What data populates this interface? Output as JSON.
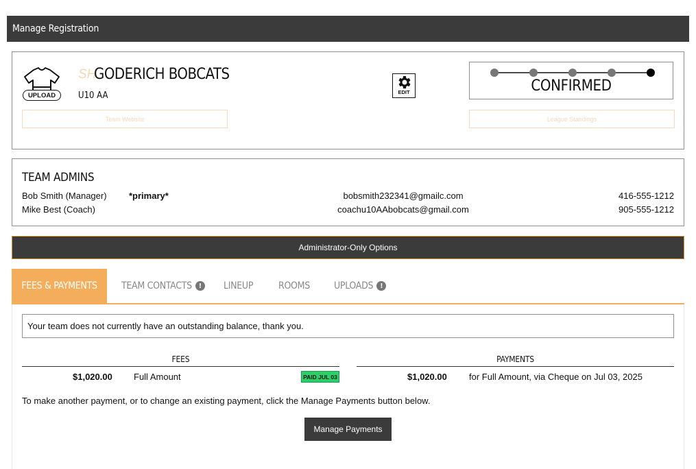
{
  "header": {
    "title": "Manage Registration"
  },
  "team": {
    "upload_label": "UPLOAD",
    "logo_text": "SH",
    "name": "GODERICH BOBCATS",
    "division": "U10 AA",
    "edit_label": "EDIT",
    "status": "CONFIRMED",
    "status_steps": 5,
    "status_current_step": 5,
    "website_label": "Team Website",
    "standings_label": "League Standings"
  },
  "admins": {
    "title": "TEAM ADMINS",
    "rows": [
      {
        "name": "Bob Smith (Manager)",
        "tag": "*primary*",
        "email": "bobsmith232341@gmailc.com",
        "phone": "416-555-1212"
      },
      {
        "name": "Mike Best (Coach)",
        "tag": "",
        "email": "coachu10AAbobcats@gmail.com",
        "phone": "905-555-1212"
      }
    ]
  },
  "admin_options_label": "Administrator-Only Options",
  "tabs": [
    {
      "label": "FEES & PAYMENTS",
      "active": true,
      "alert": false
    },
    {
      "label": "TEAM CONTACTS",
      "active": false,
      "alert": true
    },
    {
      "label": "LINEUP",
      "active": false,
      "alert": false
    },
    {
      "label": "ROOMS",
      "active": false,
      "alert": false
    },
    {
      "label": "UPLOADS",
      "active": false,
      "alert": true
    }
  ],
  "fees_panel": {
    "notice": "Your team does not currently have an outstanding balance, thank you.",
    "fees_header": "FEES",
    "payments_header": "PAYMENTS",
    "fee": {
      "amount": "$1,020.00",
      "description": "Full Amount",
      "status": "PAID JUL 03"
    },
    "payment": {
      "amount": "$1,020.00",
      "description": "for Full Amount, via Cheque on Jul 03, 2025"
    },
    "instructions": "To make another payment, or to change an existing payment, click the Manage Payments button below.",
    "manage_button": "Manage Payments"
  },
  "colors": {
    "accent": "#f3ad5b",
    "dark_bar": "#3b3b3b",
    "paid_green": "#2bd06a"
  }
}
